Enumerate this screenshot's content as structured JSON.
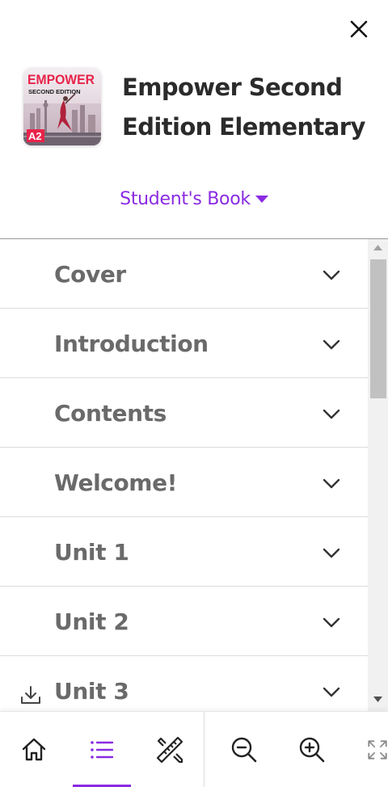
{
  "book": {
    "title": "Empower Second Edition Elementary",
    "cover": {
      "brand": "EMPOWER",
      "subtitle": "SECOND EDITION",
      "level": "A2"
    }
  },
  "edition_selector": {
    "label": "Student's Book"
  },
  "toc": {
    "items": [
      {
        "label": "Cover"
      },
      {
        "label": "Introduction"
      },
      {
        "label": "Contents"
      },
      {
        "label": "Welcome!"
      },
      {
        "label": "Unit 1"
      },
      {
        "label": "Unit 2"
      },
      {
        "label": "Unit 3"
      }
    ]
  },
  "toolbar": {
    "buttons": [
      "home-icon",
      "table-of-contents-icon",
      "tools-icon",
      "zoom-out-icon",
      "zoom-in-icon",
      "fullscreen-icon"
    ],
    "active": "table-of-contents-icon"
  },
  "colors": {
    "accent": "#8a2be2",
    "text_dark": "#2b2b2b",
    "text_muted": "#6a6a6a",
    "cover_brand": "#e8244a"
  }
}
